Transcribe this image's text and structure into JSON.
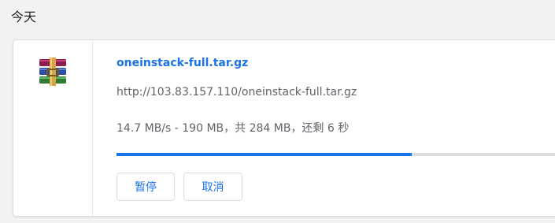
{
  "section": {
    "title": "今天"
  },
  "download": {
    "file_name": "oneinstack-full.tar.gz",
    "url": "http://103.83.157.110/oneinstack-full.tar.gz",
    "status": "14.7 MB/s - 190 MB，共 284 MB，还剩 6 秒",
    "progress_fraction": 0.669,
    "icon": "winrar-archive-icon",
    "pause_label": "暂停",
    "cancel_label": "取消"
  },
  "colors": {
    "link": "#1a73e8",
    "progress_fill": "#1a73e8",
    "progress_track": "#dcdcdc",
    "secondary_text": "#5f6368"
  }
}
